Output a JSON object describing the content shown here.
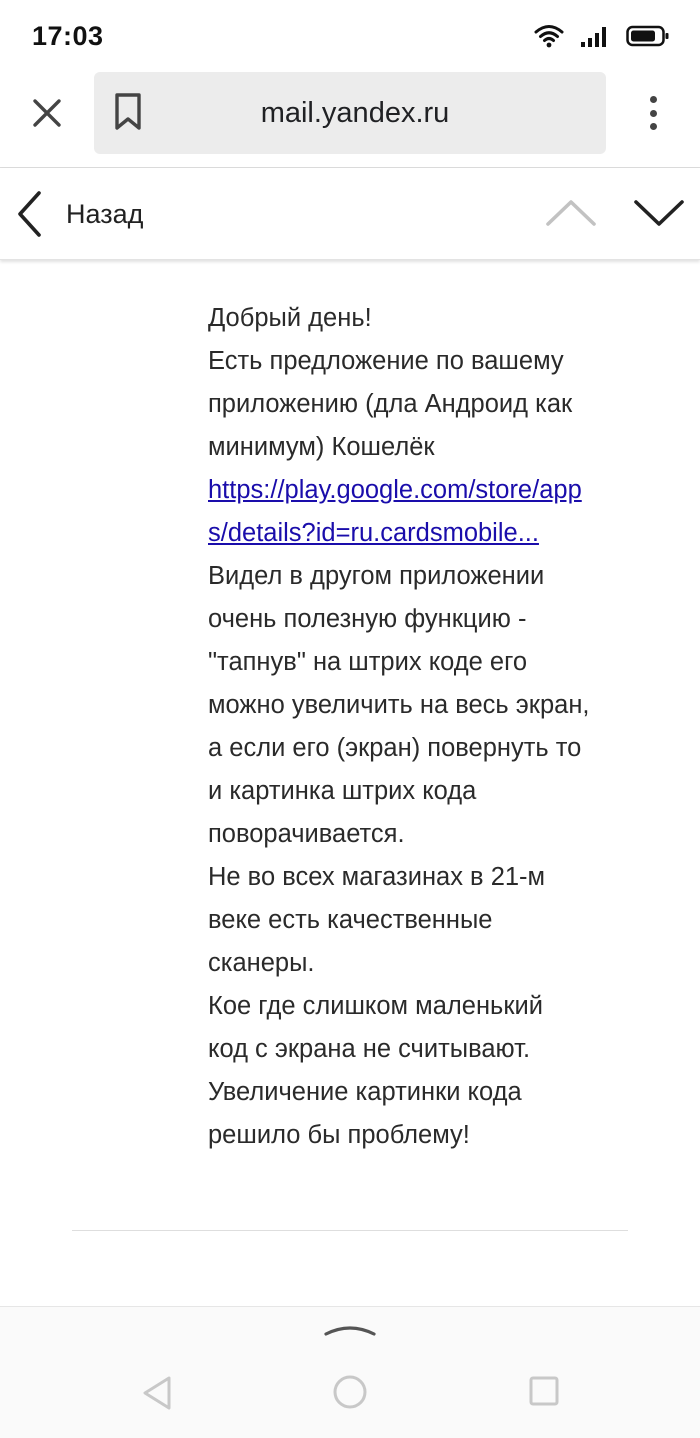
{
  "status_bar": {
    "time": "17:03",
    "icons": [
      "wifi-icon",
      "signal-icon",
      "battery-icon"
    ]
  },
  "browser": {
    "url": "mail.yandex.ru",
    "icons": [
      "close-icon",
      "bookmark-icon",
      "more-vert-icon"
    ]
  },
  "mail_nav": {
    "back_label": "Назад",
    "icons": [
      "chevron-left-icon",
      "chevron-up-icon",
      "chevron-down-icon"
    ]
  },
  "message": {
    "lines": [
      "Добрый день!",
      "Есть предложение по вашему",
      "приложению (дла Андроид как",
      "минимум) Кошелёк"
    ],
    "link_lines": [
      "https://play.google.com/store/app",
      "s/details?id=ru.cardsmobile..."
    ],
    "lines_after_link": [
      "Видел в другом приложении",
      "очень полезную функцию -",
      "\"тапнув\" на штрих коде его",
      "можно увеличить на весь экран,",
      "а если его (экран) повернуть то",
      "и картинка штрих кода",
      "поворачивается.",
      "Не во всех магазинах в 21-м",
      "веке есть качественные",
      "сканеры.",
      "Кое где слишком маленький",
      "код с экрана не считывают.",
      "Увеличение картинки кода",
      "решило бы проблему!"
    ]
  },
  "system_nav": {
    "icons": [
      "chevron-up-icon",
      "triangle-back-icon",
      "circle-home-icon",
      "square-recent-icon"
    ]
  },
  "colors": {
    "link": "#1a0dab",
    "text": "#2a2a2a",
    "url_box": "#ececec",
    "disabled_arrow": "#bdbdbd"
  }
}
